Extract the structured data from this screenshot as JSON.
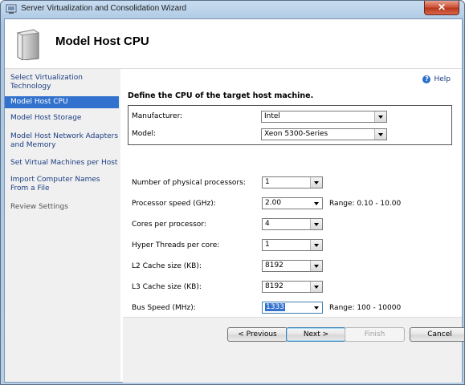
{
  "window": {
    "title": "Server Virtualization and Consolidation Wizard",
    "close_glyph": "✕"
  },
  "header": {
    "page_title": "Model Host CPU"
  },
  "sidebar": {
    "items": [
      {
        "label": "Select Virtualization Technology",
        "state": "normal"
      },
      {
        "label": "Model Host CPU",
        "state": "active"
      },
      {
        "label": "Model Host Storage",
        "state": "normal"
      },
      {
        "label": "Model Host Network Adapters and Memory",
        "state": "normal"
      },
      {
        "label": "Set Virtual Machines per Host",
        "state": "normal"
      },
      {
        "label": "Import Computer Names From a File",
        "state": "normal"
      },
      {
        "label": "Review Settings",
        "state": "disabled"
      }
    ]
  },
  "content": {
    "help_label": "Help",
    "help_glyph": "?",
    "section_title": "Define the CPU of the target host machine.",
    "manufacturer": {
      "label": "Manufacturer:",
      "value": "Intel"
    },
    "model": {
      "label": "Model:",
      "value": "Xeon 5300-Series"
    },
    "fields": [
      {
        "label": "Number of physical processors:",
        "value": "1",
        "range": ""
      },
      {
        "label": "Processor speed (GHz):",
        "value": "2.00",
        "range": "Range: 0.10 - 10.00"
      },
      {
        "label": "Cores per processor:",
        "value": "4",
        "range": ""
      },
      {
        "label": "Hyper Threads per core:",
        "value": "1",
        "range": ""
      },
      {
        "label": "L2 Cache size (KB):",
        "value": "8192",
        "range": ""
      },
      {
        "label": "L3 Cache size (KB):",
        "value": "8192",
        "range": ""
      },
      {
        "label": "Bus Speed (MHz):",
        "value": "1333",
        "range": "Range: 100 - 10000"
      }
    ]
  },
  "footer": {
    "previous": "< Previous",
    "next": "Next >",
    "finish": "Finish",
    "cancel": "Cancel"
  }
}
